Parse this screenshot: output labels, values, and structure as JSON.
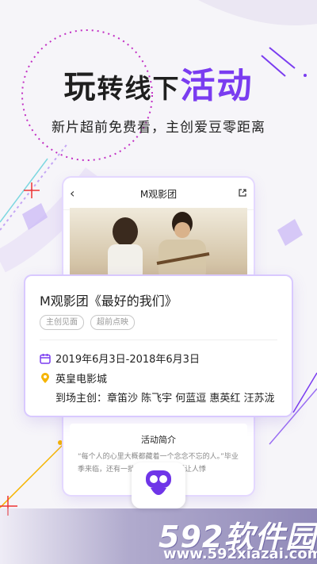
{
  "headline": {
    "part1": "玩",
    "part2": "转",
    "part3": "线下",
    "accent": "活动"
  },
  "subhead": "新片超前免费看，主创爱豆零距离",
  "phone": {
    "back_icon": "chevron-left-icon",
    "title": "M观影团",
    "share_icon": "share-icon",
    "photo_alt": "couple-with-ukulele-photo"
  },
  "event_card": {
    "title": "M观影团《最好的我们》",
    "tags": [
      "主创见面",
      "超前点映"
    ],
    "date": "2019年6月3日-2018年6月3日",
    "location": "英皇电影城",
    "guests": "到场主创：章笛沙 陈飞宇 何蓝逗 惠英红 汪苏泷",
    "colors": {
      "accent": "#7a3cf0",
      "calendar": "#7a3cf0",
      "pin": "#f5b400"
    }
  },
  "intro": {
    "title": "活动简介",
    "text": "“每个人的心里大概都藏着一个念念不忘的人。”毕业季来临，还有一批青春的爱情片更让人悸"
  },
  "watermark": {
    "logo": "592软件园",
    "url": "www.592xiazai.com"
  }
}
